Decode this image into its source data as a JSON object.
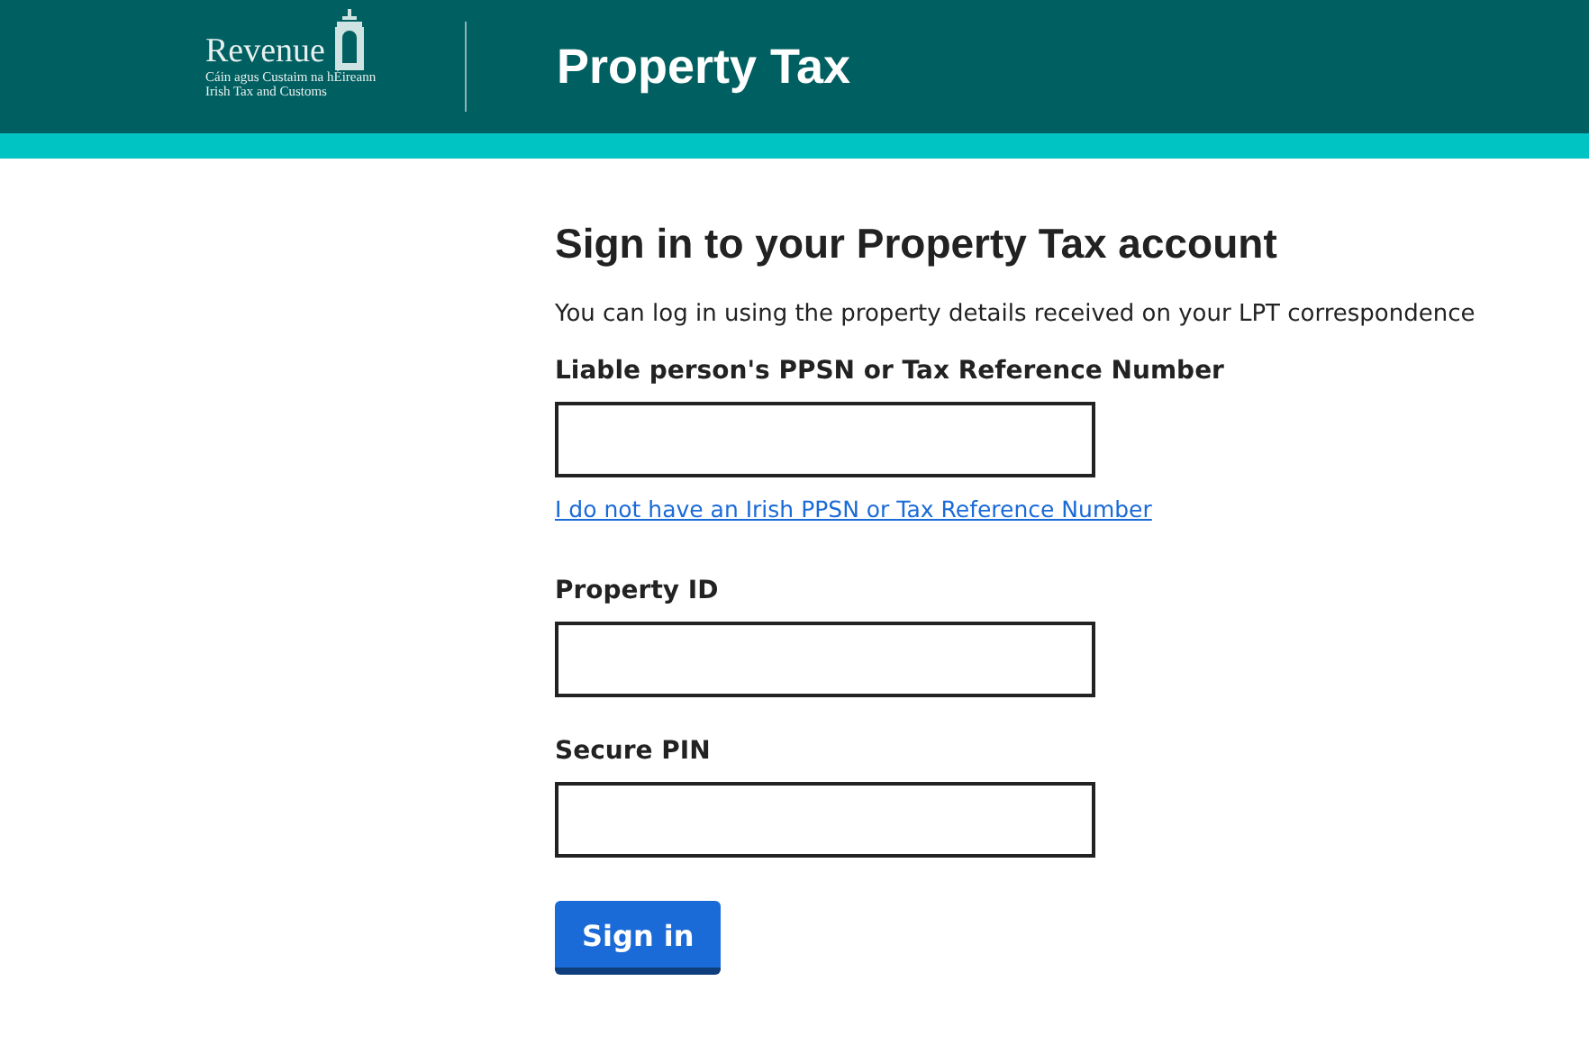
{
  "header": {
    "logo_name": "Revenue",
    "logo_line_1": "Cáin agus Custaim na hÉireann",
    "logo_line_2": "Irish Tax and Customs",
    "title": "Property Tax"
  },
  "heading": "Sign in to your Property Tax account",
  "intro": "You can log in using the property details received on your LPT correspondence",
  "fields": [
    {
      "label": "Liable person's PPSN or Tax Reference Number",
      "link": "I do not have an Irish PPSN or Tax Reference Number"
    },
    {
      "label": "Property ID"
    },
    {
      "label": "Secure PIN"
    }
  ],
  "button": "Sign in"
}
